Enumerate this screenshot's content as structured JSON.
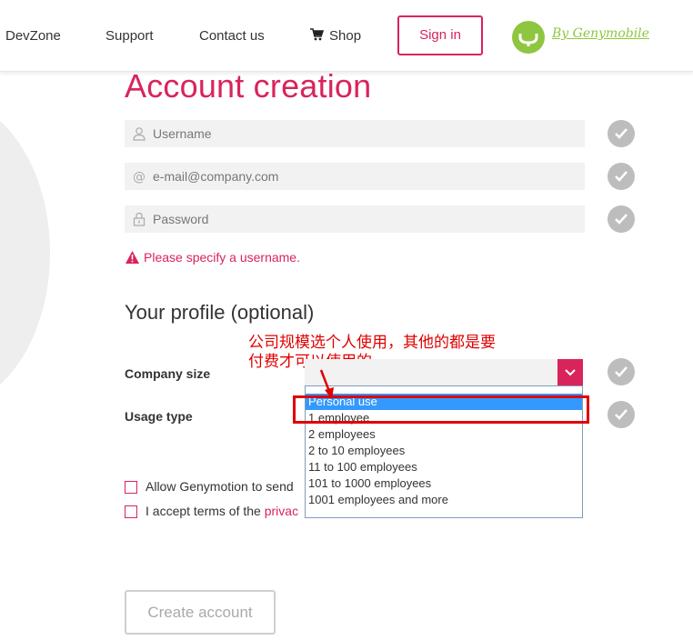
{
  "nav": {
    "items": [
      "DevZone",
      "Support",
      "Contact us",
      "Shop"
    ],
    "signin_label": "Sign in",
    "brand_text": "By Genymobile"
  },
  "form": {
    "title": "Account creation",
    "username_placeholder": "Username",
    "email_placeholder": "e-mail@company.com",
    "password_placeholder": "Password",
    "error_message": "Please specify a username."
  },
  "profile": {
    "title": "Your profile (optional)",
    "company_size_label": "Company size",
    "usage_type_label": "Usage type",
    "company_size_options": [
      "Personal use",
      "1 employee",
      "2 employees",
      "2 to 10 employees",
      "11 to 100 employees",
      "101 to 1000 employees",
      "1001 employees and more"
    ],
    "selected_option": "Personal use"
  },
  "annotation": {
    "text_line1": "公司规模选个人使用，其他的都是要",
    "text_line2": "付费才可以使用的"
  },
  "consents": {
    "allow_text": "Allow Genymotion to send",
    "accept_prefix": "I accept terms of the ",
    "accept_link": "privac"
  },
  "actions": {
    "create_label": "Create account"
  },
  "colors": {
    "accent": "#d9245b",
    "brand_green": "#8ec63f",
    "annotation_red": "#e00000",
    "selected_blue": "#3399ff"
  }
}
